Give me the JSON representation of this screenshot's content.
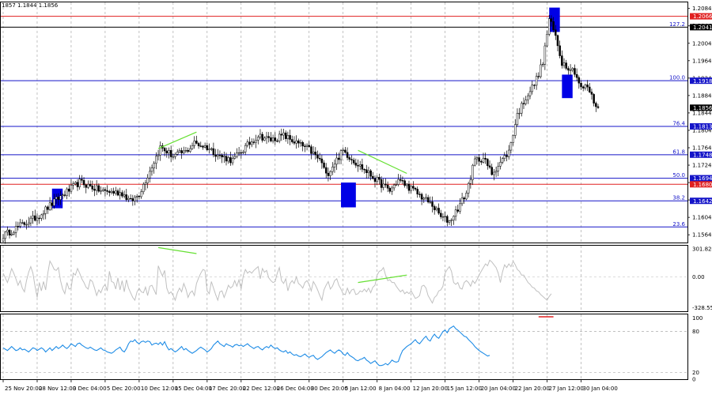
{
  "header": "1857 1.1844 1.1856",
  "chart_data": {
    "type": "candlestick",
    "instrument_quote": {
      "values": [
        "1857",
        "1.1844",
        "1.1856"
      ]
    },
    "price_panel": {
      "ylim": [
        1.1548,
        1.2098
      ],
      "y_ticks": [
        "1.2084",
        "1.2044",
        "1.2004",
        "1.1964",
        "1.1924",
        "1.1884",
        "1.1844",
        "1.1804",
        "1.1764",
        "1.1724",
        "1.1684",
        "1.1644",
        "1.1604",
        "1.1564"
      ],
      "current_price": "1.1856",
      "horizontal_levels": [
        {
          "price": 1.2066,
          "tag": "1.2066",
          "fib": "",
          "color": "#e02020"
        },
        {
          "price": 1.2041,
          "tag": "1.2041",
          "fib": "127.2",
          "color": "#000000"
        },
        {
          "price": 1.1918,
          "tag": "1.1918",
          "fib": "100.0",
          "color": "#1515c8"
        },
        {
          "price": 1.1813,
          "tag": "1.1813",
          "fib": "76.4",
          "color": "#1515c8"
        },
        {
          "price": 1.1748,
          "tag": "1.1748",
          "fib": "61.8",
          "color": "#1515c8"
        },
        {
          "price": 1.1694,
          "tag": "1.1694",
          "fib": "50.0",
          "color": "#1515c8"
        },
        {
          "price": 1.168,
          "tag": "1.1680",
          "fib": "",
          "color": "#e02020"
        },
        {
          "price": 1.1642,
          "tag": "1.1642",
          "fib": "38.2",
          "color": "#1515c8"
        },
        {
          "price": 1.1582,
          "tag": "",
          "fib": "23.6",
          "color": "#1515c8"
        }
      ],
      "price_path": [
        [
          0,
          1.1562
        ],
        [
          8,
          1.1585
        ],
        [
          16,
          1.1605
        ],
        [
          26,
          1.1648
        ],
        [
          36,
          1.1685
        ],
        [
          46,
          1.1665
        ],
        [
          56,
          1.166
        ],
        [
          60,
          1.164
        ],
        [
          64,
          1.1658
        ],
        [
          68,
          1.17
        ],
        [
          74,
          1.1765
        ],
        [
          80,
          1.1745
        ],
        [
          86,
          1.1755
        ],
        [
          90,
          1.1775
        ],
        [
          96,
          1.1765
        ],
        [
          102,
          1.1745
        ],
        [
          108,
          1.1735
        ],
        [
          114,
          1.1765
        ],
        [
          120,
          1.1792
        ],
        [
          126,
          1.1782
        ],
        [
          132,
          1.1792
        ],
        [
          138,
          1.1775
        ],
        [
          144,
          1.176
        ],
        [
          150,
          1.173
        ],
        [
          152,
          1.17
        ],
        [
          156,
          1.173
        ],
        [
          160,
          1.1757
        ],
        [
          166,
          1.173
        ],
        [
          172,
          1.1705
        ],
        [
          178,
          1.168
        ],
        [
          182,
          1.1665
        ],
        [
          186,
          1.169
        ],
        [
          192,
          1.167
        ],
        [
          196,
          1.1655
        ],
        [
          202,
          1.1632
        ],
        [
          206,
          1.1605
        ],
        [
          210,
          1.1595
        ],
        [
          214,
          1.1625
        ],
        [
          218,
          1.166
        ],
        [
          222,
          1.1735
        ],
        [
          226,
          1.174
        ],
        [
          230,
          1.1705
        ],
        [
          234,
          1.173
        ],
        [
          238,
          1.1755
        ],
        [
          242,
          1.184
        ],
        [
          246,
          1.188
        ],
        [
          250,
          1.191
        ],
        [
          254,
          1.196
        ],
        [
          257,
          1.206
        ],
        [
          260,
          1.202
        ],
        [
          263,
          1.196
        ],
        [
          266,
          1.195
        ],
        [
          269,
          1.194
        ],
        [
          272,
          1.19
        ],
        [
          275,
          1.1905
        ],
        [
          278,
          1.187
        ],
        [
          280,
          1.1856
        ]
      ],
      "blue_boxes": [
        {
          "from": 23,
          "to": 28,
          "low": 1.1625,
          "high": 1.167
        },
        {
          "from": 159,
          "to": 166,
          "low": 1.1627,
          "high": 1.1684
        },
        {
          "from": 257,
          "to": 262,
          "low": 1.203,
          "high": 1.2086
        },
        {
          "from": 263,
          "to": 268,
          "low": 1.1878,
          "high": 1.1932
        }
      ],
      "green_divergence_lines": [
        {
          "from": [
            73,
            1.1762
          ],
          "to": [
            91,
            1.18
          ]
        },
        {
          "from": [
            167,
            1.1758
          ],
          "to": [
            190,
            1.1705
          ]
        }
      ]
    },
    "oscillator_1": {
      "ylim": [
        -360,
        335
      ],
      "y_ticks": [
        "301.8242",
        "0.00",
        "-328.551"
      ],
      "zero_line": 0,
      "color": "#c0c0c0",
      "values": [
        40,
        -10,
        -60,
        10,
        90,
        40,
        -20,
        -90,
        -40,
        -120,
        -160,
        -40,
        50,
        110,
        40,
        -100,
        -220,
        -60,
        -150,
        -50,
        -140,
        40,
        170,
        130,
        80,
        70,
        100,
        -40,
        -130,
        -180,
        -60,
        -130,
        -120,
        40,
        20,
        90,
        40,
        -20,
        -60,
        -110,
        -130,
        -30,
        -50,
        -120,
        -200,
        -140,
        -170,
        -110,
        -80,
        -150,
        60,
        -50,
        -60,
        -130,
        -10,
        -140,
        -40,
        -160,
        -30,
        -120,
        -170,
        -220,
        -250,
        -160,
        -120,
        -160,
        -170,
        -110,
        -200,
        -100,
        -90,
        -140,
        -190,
        120,
        60,
        10,
        70,
        -120,
        -180,
        -160,
        -200,
        -250,
        -170,
        -120,
        -160,
        -70,
        -130,
        -220,
        -170,
        -150,
        -200,
        -70,
        -10,
        40,
        80,
        70,
        -150,
        -180,
        -50,
        -120,
        -190,
        -250,
        -160,
        -150,
        -220,
        -160,
        -90,
        -120,
        -100,
        -40,
        -100,
        -30,
        -130,
        10,
        80,
        40,
        60,
        40,
        70,
        90,
        110,
        -20,
        90,
        50,
        70,
        -10,
        -40,
        -60,
        -50,
        40,
        100,
        -40,
        -70,
        -20,
        -150,
        -70,
        -40,
        -70,
        0,
        -70,
        -90,
        -120,
        -60,
        -40,
        -80,
        -150,
        -50,
        -90,
        -140,
        -200,
        -250,
        -140,
        -90,
        -50,
        -130,
        -100,
        -40,
        -20,
        -90,
        -130,
        -180,
        -190,
        -120,
        -180,
        -140,
        -130,
        -190,
        -180,
        -150,
        -160,
        -130,
        -160,
        -120,
        -170,
        -110,
        -90,
        20,
        60,
        70,
        100,
        20,
        -40,
        -30,
        -60,
        -60,
        -100,
        -130,
        -160,
        -140,
        -180,
        -160,
        -180,
        -150,
        -190,
        -230,
        -220,
        -200,
        -100,
        -90,
        -120,
        -200,
        -240,
        -280,
        -220,
        -200,
        -150,
        -140,
        -100,
        40,
        80,
        110,
        60,
        -60,
        -80,
        -60,
        -120,
        -130,
        -60,
        -40,
        -60,
        -100,
        -40,
        -70,
        -30,
        20,
        60,
        100,
        140,
        120,
        180,
        160,
        130,
        100,
        40,
        -60,
        50,
        130,
        100,
        140,
        110,
        170,
        130,
        80,
        60,
        20,
        20,
        -20,
        -60,
        -80,
        -110,
        -120,
        -150,
        -160,
        -190,
        -210,
        -230,
        -250,
        -210,
        -180
      ],
      "green_divergence_lines": [
        {
          "from": [
            73,
            315
          ],
          "to": [
            91,
            250
          ]
        },
        {
          "from": [
            167,
            -60
          ],
          "to": [
            190,
            20
          ]
        }
      ]
    },
    "oscillator_2": {
      "ylim": [
        10,
        105
      ],
      "y_ticks": [
        "100",
        "80",
        "20",
        "0"
      ],
      "dashed_levels": [
        80,
        20
      ],
      "color": "#1e8ce6",
      "values": [
        56,
        54,
        52,
        55,
        58,
        55,
        52,
        53,
        56,
        53,
        54,
        52,
        50,
        53,
        56,
        55,
        52,
        54,
        56,
        54,
        50,
        53,
        56,
        52,
        55,
        58,
        55,
        57,
        60,
        57,
        55,
        58,
        62,
        60,
        58,
        62,
        63,
        60,
        58,
        56,
        55,
        57,
        55,
        53,
        52,
        54,
        56,
        53,
        52,
        50,
        49,
        48,
        50,
        53,
        55,
        57,
        52,
        50,
        55,
        62,
        66,
        65,
        68,
        64,
        62,
        65,
        66,
        64,
        66,
        65,
        60,
        62,
        63,
        61,
        64,
        60,
        65,
        58,
        53,
        55,
        52,
        50,
        52,
        55,
        58,
        53,
        55,
        52,
        50,
        48,
        50,
        52,
        55,
        57,
        55,
        53,
        50,
        52,
        55,
        60,
        63,
        66,
        62,
        60,
        58,
        62,
        60,
        59,
        57,
        60,
        61,
        59,
        60,
        58,
        60,
        62,
        59,
        57,
        55,
        57,
        58,
        55,
        53,
        56,
        58,
        56,
        60,
        57,
        55,
        56,
        53,
        51,
        50,
        52,
        48,
        50,
        47,
        45,
        46,
        44,
        43,
        45,
        47,
        44,
        42,
        44,
        45,
        41,
        39,
        41,
        43,
        46,
        49,
        51,
        53,
        50,
        48,
        51,
        53,
        51,
        47,
        45,
        49,
        45,
        43,
        41,
        38,
        37,
        39,
        40,
        42,
        38,
        36,
        33,
        35,
        37,
        33,
        30,
        30,
        31,
        33,
        31,
        34,
        38,
        36,
        35,
        36,
        45,
        52,
        55,
        58,
        60,
        62,
        65,
        68,
        64,
        62,
        66,
        70,
        73,
        68,
        66,
        72,
        76,
        72,
        70,
        75,
        80,
        82,
        78,
        84,
        86,
        88,
        84,
        82,
        79,
        76,
        73,
        72,
        68,
        65,
        62,
        58,
        55,
        52,
        50,
        48,
        46,
        44,
        45
      ]
    },
    "x_axis_labels": [
      {
        "i": 0,
        "label": "25 Nov 20:00"
      },
      {
        "i": 16,
        "label": "28 Nov 12:00"
      },
      {
        "i": 32,
        "label": "3 Dec 04:00"
      },
      {
        "i": 48,
        "label": "5 Dec 20:00"
      },
      {
        "i": 64,
        "label": "10 Dec 12:00"
      },
      {
        "i": 80,
        "label": "15 Dec 04:00"
      },
      {
        "i": 96,
        "label": "17 Dec 20:00"
      },
      {
        "i": 112,
        "label": "22 Dec 12:00"
      },
      {
        "i": 128,
        "label": "26 Dec 04:00"
      },
      {
        "i": 144,
        "label": "30 Dec 20:00"
      },
      {
        "i": 160,
        "label": "5 Jan 12:00"
      },
      {
        "i": 176,
        "label": "8 Jan 04:00"
      },
      {
        "i": 192,
        "label": "12 Jan 20:00"
      },
      {
        "i": 208,
        "label": "15 Jan 12:00"
      },
      {
        "i": 224,
        "label": "20 Jan 04:00"
      },
      {
        "i": 240,
        "label": "22 Jan 20:00"
      },
      {
        "i": 256,
        "label": "27 Jan 12:00"
      },
      {
        "i": 272,
        "label": "30 Jan 04:00"
      }
    ],
    "colors": {
      "candle": "#000000",
      "box": "#0000e6",
      "divergence": "#66e033",
      "fib_line": "#1515c8",
      "resistance_red": "#e02020",
      "oscillator_1": "#c0c0c0",
      "oscillator_2": "#1e8ce6",
      "current_price_bg": "#000000",
      "red_marker": "#e02020"
    }
  }
}
